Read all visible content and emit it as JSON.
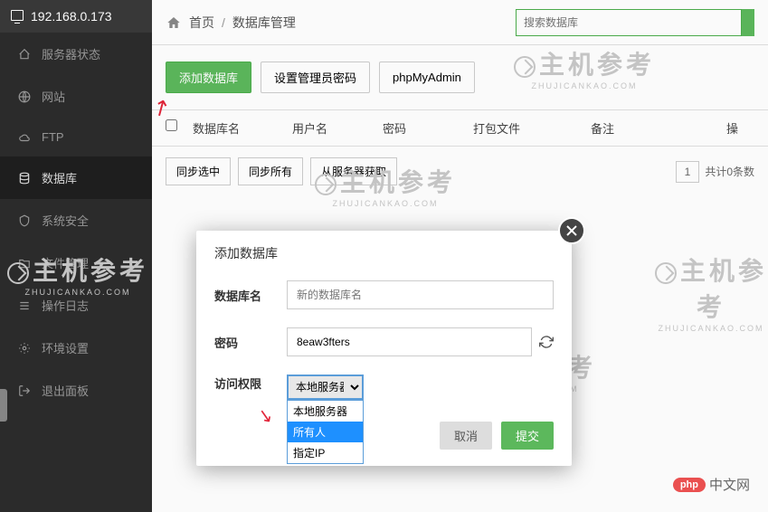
{
  "server_ip": "192.168.0.173",
  "sidebar": {
    "items": [
      {
        "label": "服务器状态"
      },
      {
        "label": "网站"
      },
      {
        "label": "FTP"
      },
      {
        "label": "数据库"
      },
      {
        "label": "系统安全"
      },
      {
        "label": "文件管理"
      },
      {
        "label": "操作日志"
      },
      {
        "label": "环境设置"
      },
      {
        "label": "退出面板"
      }
    ]
  },
  "breadcrumb": {
    "home": "首页",
    "current": "数据库管理"
  },
  "search": {
    "placeholder": "搜索数据库"
  },
  "buttons": {
    "add_db": "添加数据库",
    "set_pwd": "设置管理员密码",
    "phpmyadmin": "phpMyAdmin",
    "sync_sel": "同步选中",
    "sync_all": "同步所有",
    "fetch": "从服务器获取"
  },
  "table": {
    "headers": {
      "name": "数据库名",
      "user": "用户名",
      "pwd": "密码",
      "bundle": "打包文件",
      "note": "备注",
      "ops": "操"
    }
  },
  "pager": {
    "page": "1",
    "summary": "共计0条数"
  },
  "watermark": {
    "text": "主机参考",
    "sub": "ZHUJICANKAO.COM"
  },
  "modal": {
    "title": "添加数据库",
    "fields": {
      "name_label": "数据库名",
      "name_placeholder": "新的数据库名",
      "pwd_label": "密码",
      "pwd_value": "8eaw3fters",
      "perm_label": "访问权限",
      "perm_selected": "本地服务器"
    },
    "dropdown": [
      "本地服务器",
      "所有人",
      "指定IP"
    ],
    "cancel": "取消",
    "submit": "提交"
  },
  "php_badge": {
    "logo": "php",
    "text": "中文网"
  }
}
